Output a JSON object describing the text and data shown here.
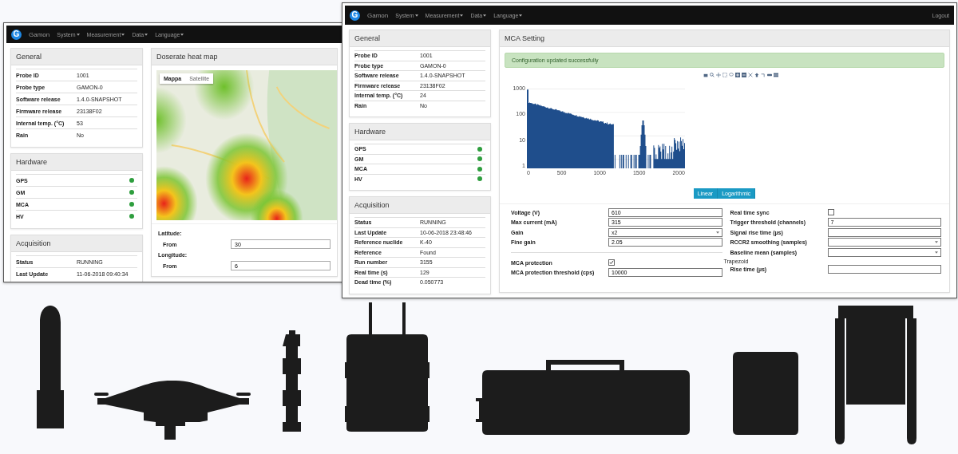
{
  "windows": [
    {
      "navbar": {
        "logo": "G",
        "brand": "Gamon",
        "menus": [
          "System",
          "Measurement",
          "Data",
          "Language"
        ]
      },
      "general": {
        "title": "General",
        "rows": [
          {
            "label": "Probe ID",
            "value": "1001"
          },
          {
            "label": "Probe type",
            "value": "GAMON-0"
          },
          {
            "label": "Software release",
            "value": "1.4.0-SNAPSHOT"
          },
          {
            "label": "Firmware release",
            "value": "23138F02"
          },
          {
            "label": "Internal temp. (°C)",
            "value": "53"
          },
          {
            "label": "Rain",
            "value": "No"
          }
        ]
      },
      "hardware": {
        "title": "Hardware",
        "items": [
          {
            "label": "GPS",
            "ok": true
          },
          {
            "label": "GM",
            "ok": true
          },
          {
            "label": "MCA",
            "ok": true
          },
          {
            "label": "HV",
            "ok": true
          }
        ]
      },
      "acquisition": {
        "title": "Acquisition",
        "rows": [
          {
            "label": "Status",
            "value": "RUNNING"
          },
          {
            "label": "Last Update",
            "value": "11-06-2018 09:40:34"
          }
        ]
      },
      "map_panel": {
        "title": "Doserate heat map",
        "tabs": [
          {
            "label": "Mappa",
            "selected": true
          },
          {
            "label": "Satellite",
            "selected": false
          }
        ],
        "filters": [
          {
            "title": "Latitude:",
            "label": "From",
            "value": "30"
          },
          {
            "title": "Longitude:",
            "label": "From",
            "value": "6"
          }
        ]
      }
    },
    {
      "navbar": {
        "logo": "G",
        "brand": "Gamon",
        "menus": [
          "System",
          "Measurement",
          "Data",
          "Language"
        ],
        "logout": "Logout"
      },
      "general": {
        "title": "General",
        "rows": [
          {
            "label": "Probe ID",
            "value": "1001"
          },
          {
            "label": "Probe type",
            "value": "GAMON-0"
          },
          {
            "label": "Software release",
            "value": "1.4.0-SNAPSHOT"
          },
          {
            "label": "Firmware release",
            "value": "23138F02"
          },
          {
            "label": "Internal temp. (°C)",
            "value": "24"
          },
          {
            "label": "Rain",
            "value": "No"
          }
        ]
      },
      "hardware": {
        "title": "Hardware",
        "items": [
          {
            "label": "GPS",
            "ok": true
          },
          {
            "label": "GM",
            "ok": true
          },
          {
            "label": "MCA",
            "ok": true
          },
          {
            "label": "HV",
            "ok": true
          }
        ]
      },
      "acquisition": {
        "title": "Acquisition",
        "rows": [
          {
            "label": "Status",
            "value": "RUNNING"
          },
          {
            "label": "Last Update",
            "value": "10-06-2018 23:48:46"
          },
          {
            "label": "Reference nuclide",
            "value": "K-40"
          },
          {
            "label": "Reference",
            "value": "Found"
          },
          {
            "label": "Run number",
            "value": "3155"
          },
          {
            "label": "Real time (s)",
            "value": "129"
          },
          {
            "label": "Dead time (%)",
            "value": "0.050773"
          }
        ]
      },
      "mca_panel": {
        "title": "MCA Setting",
        "alert": "Configuration updated successfully",
        "spectrum": {
          "y_tick_labels": [
            "1000",
            "100",
            "10",
            "1"
          ],
          "x_tick_labels": [
            "0",
            "500",
            "1000",
            "1500",
            "2000"
          ]
        },
        "scale_buttons": [
          {
            "label": "Linear"
          },
          {
            "label": "Logarithmic"
          }
        ],
        "form_left": [
          [
            {
              "kind": "text",
              "label": "Voltage (V)",
              "value": "610"
            },
            {
              "kind": "text",
              "label": "Max current (mA)",
              "value": "315"
            },
            {
              "kind": "select",
              "label": "Gain",
              "value": "x2"
            },
            {
              "kind": "text",
              "label": "Fine gain",
              "value": "2.05"
            }
          ],
          [
            {
              "kind": "checkbox",
              "label": "MCA protection",
              "checked": true
            },
            {
              "kind": "text",
              "label": "MCA protection threshold (cps)",
              "value": "10000"
            }
          ]
        ],
        "form_right": [
          {
            "kind": "checkbox",
            "label": "Real time sync",
            "checked": false
          },
          {
            "kind": "text",
            "label": "Trigger threshold (channels)",
            "value": "7"
          },
          {
            "kind": "text",
            "label": "Signal rise time (µs)"
          },
          {
            "kind": "select",
            "label": "RCCR2 smoothing (samples)"
          },
          {
            "kind": "select",
            "label": "Baseline mean (samples)"
          },
          {
            "kind": "heading",
            "label": "Trapezoid"
          },
          {
            "kind": "text",
            "label": "Rise time (µs)"
          }
        ]
      }
    }
  ]
}
